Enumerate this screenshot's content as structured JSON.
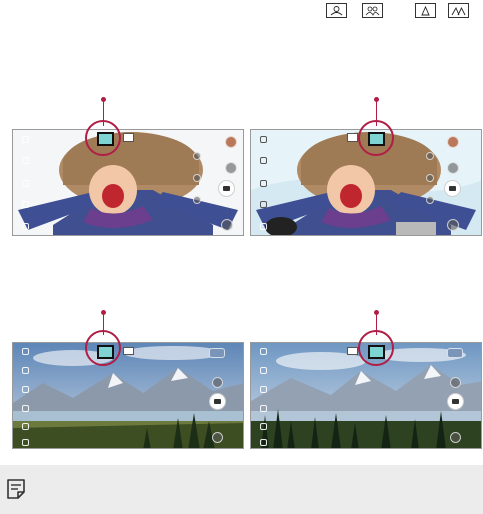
{
  "top_icons": [
    {
      "name": "portrait-icon"
    },
    {
      "name": "group-icon"
    },
    {
      "name": "landscape-icon"
    },
    {
      "name": "wide-landscape-icon"
    }
  ],
  "note": {
    "icon": "note-icon"
  },
  "colors": {
    "callout": "#b01e45",
    "active_mode": "#7ed3d3"
  }
}
